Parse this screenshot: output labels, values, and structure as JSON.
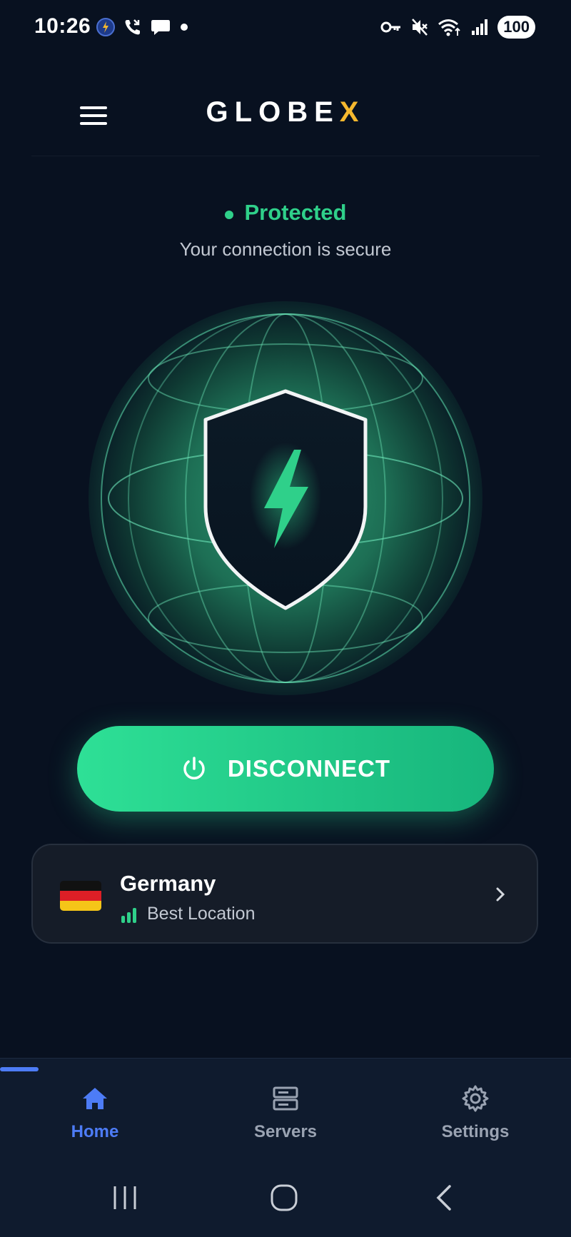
{
  "status_bar": {
    "time": "10:26",
    "battery": "100"
  },
  "header": {
    "logo_main": "GLOBE",
    "logo_accent": "X"
  },
  "connection": {
    "status": "Protected",
    "subtitle": "Your connection is secure"
  },
  "action": {
    "button_label": "DISCONNECT"
  },
  "location": {
    "country": "Germany",
    "subtitle": "Best Location"
  },
  "bottom_nav": {
    "items": [
      {
        "label": "Home",
        "icon": "home-icon",
        "active": true
      },
      {
        "label": "Servers",
        "icon": "servers-icon",
        "active": false
      },
      {
        "label": "Settings",
        "icon": "gear-icon",
        "active": false
      }
    ]
  },
  "colors": {
    "background": "#081120",
    "accent_green": "#2fd08a",
    "logo_accent": "#f5b82e",
    "nav_active": "#4d7cf6",
    "nav_inactive": "#9aa3b2"
  }
}
